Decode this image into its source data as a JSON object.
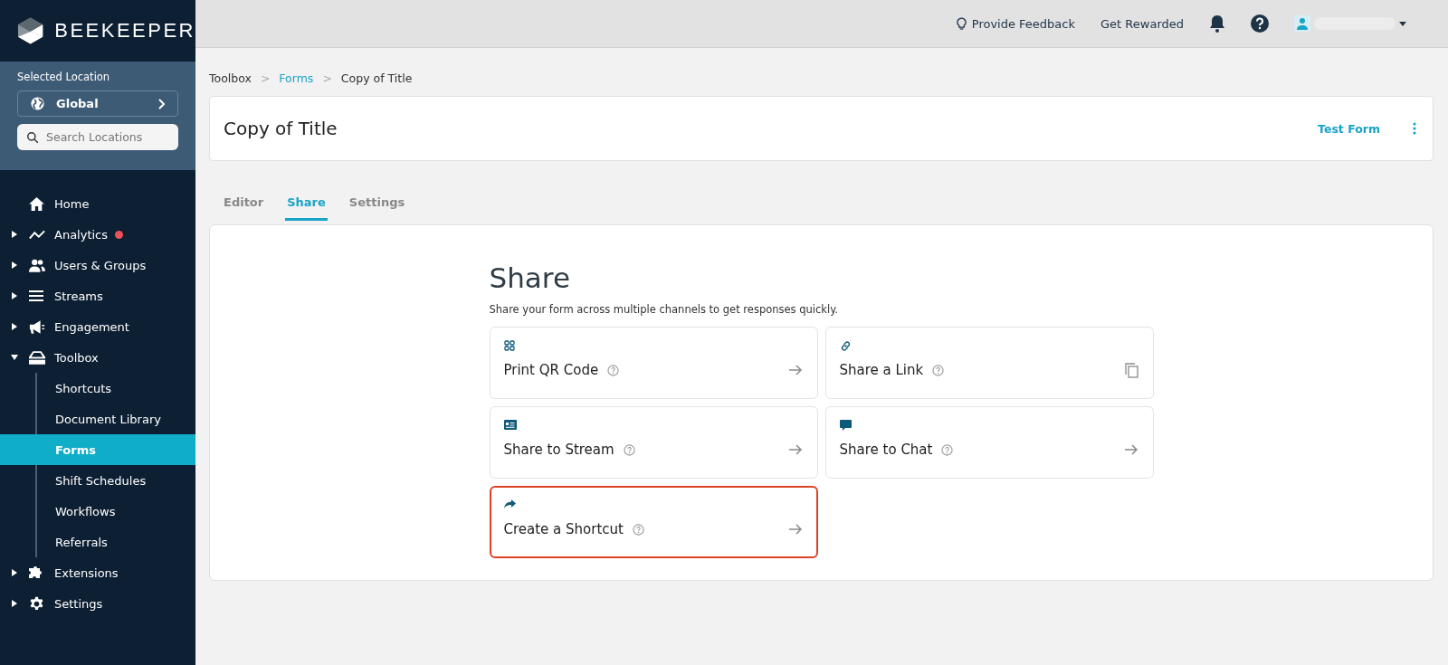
{
  "brand": {
    "name": "BEEKEEPER"
  },
  "location": {
    "label": "Selected Location",
    "value": "Global",
    "search_placeholder": "Search Locations"
  },
  "nav": [
    {
      "kind": "link",
      "label": "Home",
      "alert": false
    },
    {
      "kind": "group",
      "label": "Analytics",
      "expanded": false,
      "alert": true
    },
    {
      "kind": "group",
      "label": "Users & Groups",
      "expanded": false,
      "alert": false
    },
    {
      "kind": "group",
      "label": "Streams",
      "expanded": false,
      "alert": false
    },
    {
      "kind": "group",
      "label": "Engagement",
      "expanded": false,
      "alert": false
    },
    {
      "kind": "group",
      "label": "Toolbox",
      "expanded": true,
      "alert": false,
      "children": [
        {
          "label": "Shortcuts",
          "selected": false
        },
        {
          "label": "Document Library",
          "selected": false
        },
        {
          "label": "Forms",
          "selected": true
        },
        {
          "label": "Shift Schedules",
          "selected": false
        },
        {
          "label": "Workflows",
          "selected": false
        },
        {
          "label": "Referrals",
          "selected": false
        }
      ]
    },
    {
      "kind": "group",
      "label": "Extensions",
      "expanded": false,
      "alert": false
    },
    {
      "kind": "group",
      "label": "Settings",
      "expanded": false,
      "alert": false
    }
  ],
  "topbar": {
    "feedback": "Provide Feedback",
    "rewards": "Get Rewarded"
  },
  "breadcrumbs": [
    {
      "label": "Toolbox",
      "link": false
    },
    {
      "separator": ">",
      "label": "Forms",
      "link": true
    },
    {
      "separator": ">",
      "label": "Copy of Title",
      "link": false
    }
  ],
  "form": {
    "title": "Copy of Title",
    "test_button": "Test Form"
  },
  "tabs": [
    {
      "label": "Editor",
      "selected": false
    },
    {
      "label": "Share",
      "selected": true
    },
    {
      "label": "Settings",
      "selected": false
    }
  ],
  "share": {
    "heading": "Share",
    "description": "Share your form across multiple channels to get responses quickly.",
    "options": [
      {
        "kind": "arrow",
        "label": "Print QR Code",
        "highlighted": false
      },
      {
        "kind": "copy",
        "label": "Share a Link",
        "highlighted": false
      },
      {
        "kind": "arrow",
        "label": "Share to Stream",
        "highlighted": false
      },
      {
        "kind": "arrow",
        "label": "Share to Chat",
        "highlighted": false
      },
      {
        "kind": "arrow",
        "label": "Create a Shortcut",
        "highlighted": true
      }
    ]
  }
}
